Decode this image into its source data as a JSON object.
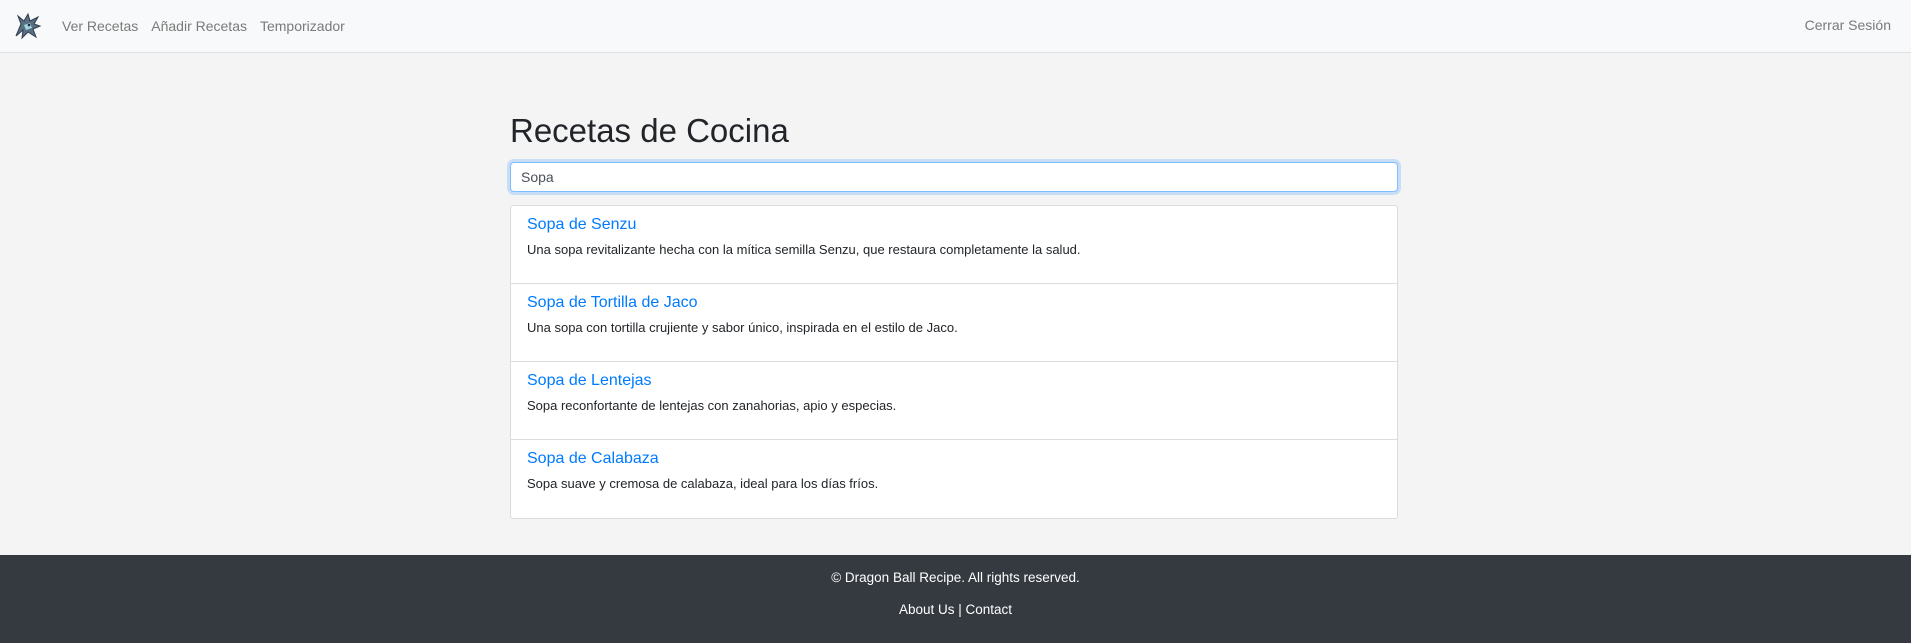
{
  "nav": {
    "logo_icon": "dragon-logo-icon",
    "links": [
      "Ver Recetas",
      "Añadir Recetas",
      "Temporizador"
    ],
    "logout": "Cerrar Sesión"
  },
  "main": {
    "title": "Recetas de Cocina",
    "search_value": "Sopa",
    "recipes": [
      {
        "title": "Sopa de Senzu",
        "desc": "Una sopa revitalizante hecha con la mítica semilla Senzu, que restaura completamente la salud."
      },
      {
        "title": "Sopa de Tortilla de Jaco",
        "desc": "Una sopa con tortilla crujiente y sabor único, inspirada en el estilo de Jaco."
      },
      {
        "title": "Sopa de Lentejas",
        "desc": "Sopa reconfortante de lentejas con zanahorias, apio y especias."
      },
      {
        "title": "Sopa de Calabaza",
        "desc": "Sopa suave y cremosa de calabaza, ideal para los días fríos."
      }
    ]
  },
  "footer": {
    "copyright": "© Dragon Ball Recipe. All rights reserved.",
    "about": "About Us",
    "separator": "|",
    "contact": "Contact"
  },
  "colors": {
    "link": "#007bff",
    "footer_bg": "#343a40",
    "navbar_bg": "#f8f9fa",
    "page_bg": "#f4f4f4"
  }
}
